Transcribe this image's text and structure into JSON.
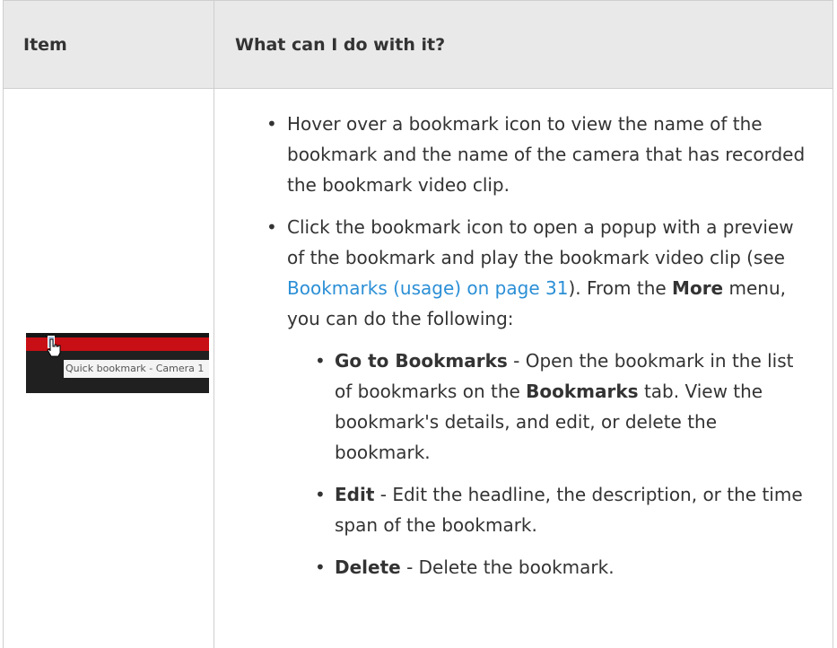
{
  "table": {
    "headers": {
      "item": "Item",
      "what": "What can I do with it?"
    }
  },
  "thumbnail": {
    "tooltip": "Quick bookmark - Camera 1"
  },
  "bullets": {
    "hover": "Hover over a bookmark icon to view the name of the bookmark and the name of the camera that has recorded the bookmark video clip.",
    "click_prefix": "Click the bookmark icon to open a popup with a preview of the bookmark and play the bookmark video clip (see ",
    "click_link": "Bookmarks (usage) on page 31",
    "click_middle": "). From the ",
    "click_more": "More",
    "click_suffix": " menu, you can do the following:"
  },
  "sub_bullets": {
    "goto_label": "Go to Bookmarks",
    "goto_text_a": " - Open the bookmark in the list of bookmarks on the ",
    "goto_tab": "Bookmarks",
    "goto_text_b": " tab. View the bookmark's details, and edit, or delete the bookmark.",
    "edit_label": "Edit",
    "edit_text": " - Edit the headline, the description, or the time span of the bookmark.",
    "delete_label": "Delete",
    "delete_text": " - Delete the bookmark."
  },
  "colors": {
    "header_bg": "#e9e9e9",
    "link": "#2b8fd6",
    "timeline_red": "#c80f15"
  },
  "icons": {
    "bullet": "bullet-dot",
    "cursor": "hand-cursor-icon",
    "bookmark_marker": "bookmark-marker-icon"
  }
}
